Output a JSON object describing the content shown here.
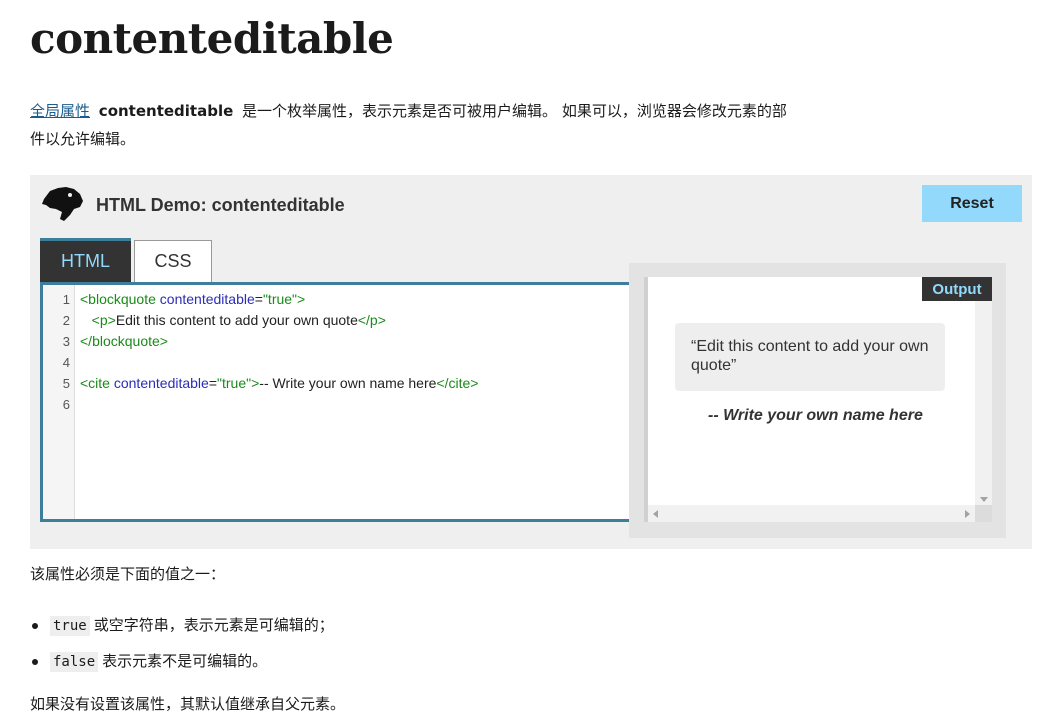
{
  "page": {
    "title": "contenteditable"
  },
  "intro": {
    "link_text": "全局属性",
    "attribute_name": "contenteditable",
    "description": "是一个枚举属性，表示元素是否可被用户编辑。 如果可以，浏览器会修改元素的部件以允许编辑。"
  },
  "demo": {
    "title": "HTML Demo: contenteditable",
    "reset_label": "Reset",
    "tabs": [
      {
        "label": "HTML",
        "active": true
      },
      {
        "label": "CSS",
        "active": false
      }
    ],
    "line_numbers": [
      "1",
      "2",
      "3",
      "4",
      "5",
      "6"
    ],
    "code": {
      "l1_open": "<blockquote",
      "l1_attr": " contenteditable",
      "l1_eq": "=",
      "l1_val": "\"true\"",
      "l1_close": ">",
      "l2_indent": "   ",
      "l2_open": "<p>",
      "l2_text": "Edit this content to add your own quote",
      "l2_close": "</p>",
      "l3": "</blockquote>",
      "l5_open": "<cite",
      "l5_attr": " contenteditable",
      "l5_eq": "=",
      "l5_val": "\"true\"",
      "l5_close": ">",
      "l5_text": "-- Write your own name here",
      "l5_end": "</cite>"
    },
    "output": {
      "label": "Output",
      "quote": "“Edit this content to add your own quote”",
      "cite": "-- Write your own name here"
    },
    "colors": {
      "accent_blue": "#3d7e9a",
      "reset_bg": "#92d9fb",
      "tag_green": "#1a8a1a",
      "attr_blue": "#2c2cb8"
    }
  },
  "values": {
    "intro": "该属性必须是下面的值之一：",
    "items": [
      {
        "code": "true",
        "text": "或空字符串，表示元素是可编辑的；"
      },
      {
        "code": "false",
        "text": "表示元素不是可编辑的。"
      }
    ]
  },
  "footer": {
    "text": "如果没有设置该属性，其默认值继承自父元素。"
  },
  "icons": {
    "logo": "dinosaur-head-icon"
  }
}
